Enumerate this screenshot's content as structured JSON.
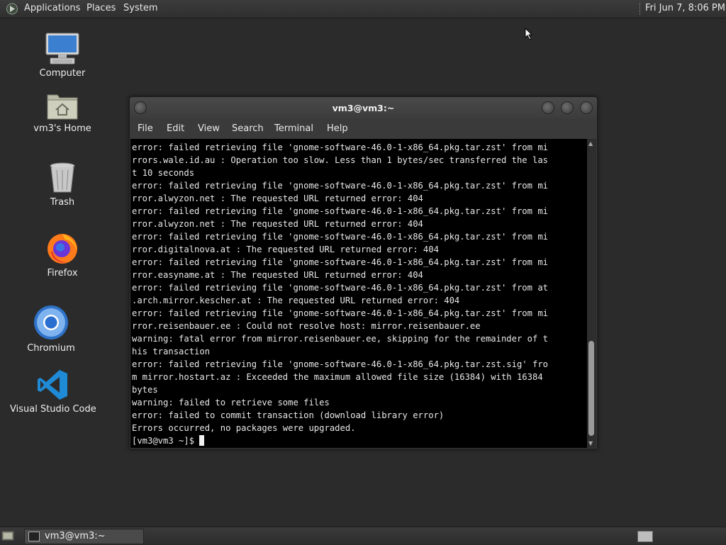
{
  "top_panel": {
    "menus": [
      "Applications",
      "Places",
      "System"
    ],
    "clock": "Fri Jun  7,  8:06 PM"
  },
  "desktop": {
    "icons": [
      "Computer",
      "vm3's Home",
      "Trash",
      "Firefox",
      "Chromium",
      "Visual Studio Code"
    ]
  },
  "terminal": {
    "title": "vm3@vm3:~",
    "menu": [
      "File",
      "Edit",
      "View",
      "Search",
      "Terminal",
      "Help"
    ],
    "lines": [
      "error: failed retrieving file 'gnome-software-46.0-1-x86_64.pkg.tar.zst' from mi",
      "rrors.wale.id.au : Operation too slow. Less than 1 bytes/sec transferred the las",
      "t 10 seconds",
      "error: failed retrieving file 'gnome-software-46.0-1-x86_64.pkg.tar.zst' from mi",
      "rror.alwyzon.net : The requested URL returned error: 404",
      "error: failed retrieving file 'gnome-software-46.0-1-x86_64.pkg.tar.zst' from mi",
      "rror.alwyzon.net : The requested URL returned error: 404",
      "error: failed retrieving file 'gnome-software-46.0-1-x86_64.pkg.tar.zst' from mi",
      "rror.digitalnova.at : The requested URL returned error: 404",
      "error: failed retrieving file 'gnome-software-46.0-1-x86_64.pkg.tar.zst' from mi",
      "rror.easyname.at : The requested URL returned error: 404",
      "error: failed retrieving file 'gnome-software-46.0-1-x86_64.pkg.tar.zst' from at",
      ".arch.mirror.kescher.at : The requested URL returned error: 404",
      "error: failed retrieving file 'gnome-software-46.0-1-x86_64.pkg.tar.zst' from mi",
      "rror.reisenbauer.ee : Could not resolve host: mirror.reisenbauer.ee",
      "warning: fatal error from mirror.reisenbauer.ee, skipping for the remainder of t",
      "his transaction",
      "error: failed retrieving file 'gnome-software-46.0-1-x86_64.pkg.tar.zst.sig' fro",
      "m mirror.hostart.az : Exceeded the maximum allowed file size (16384) with 16384",
      "bytes",
      "warning: failed to retrieve some files",
      "error: failed to commit transaction (download library error)",
      "Errors occurred, no packages were upgraded."
    ],
    "prompt": "[vm3@vm3 ~]$ "
  },
  "taskbar": {
    "task_label": "vm3@vm3:~"
  }
}
